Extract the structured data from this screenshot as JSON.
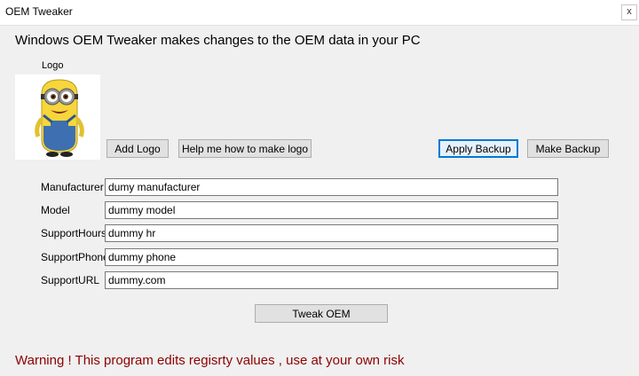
{
  "window": {
    "title": "OEM Tweaker",
    "close_glyph": "x"
  },
  "headline": "Windows OEM Tweaker makes changes to the OEM data in your PC",
  "logo": {
    "caption": "Logo",
    "image_icon": "minion-logo-image"
  },
  "buttons": {
    "add_logo": "Add Logo",
    "help_logo": "Help me how to make logo",
    "apply_backup": "Apply Backup",
    "make_backup": "Make Backup",
    "tweak_oem": "Tweak OEM"
  },
  "fields": [
    {
      "label": "Manufacturer",
      "value": "dumy manufacturer"
    },
    {
      "label": "Model",
      "value": "dummy model"
    },
    {
      "label": "SupportHours",
      "value": "dummy hr"
    },
    {
      "label": "SupportPhone",
      "value": "dummy phone"
    },
    {
      "label": "SupportURL",
      "value": "dummy.com"
    }
  ],
  "warning": "Warning ! This program edits regisrty values , use at your own risk",
  "colors": {
    "warning": "#8b0000",
    "window_bg": "#f0f0f0",
    "default_button_border": "#0078d7"
  }
}
